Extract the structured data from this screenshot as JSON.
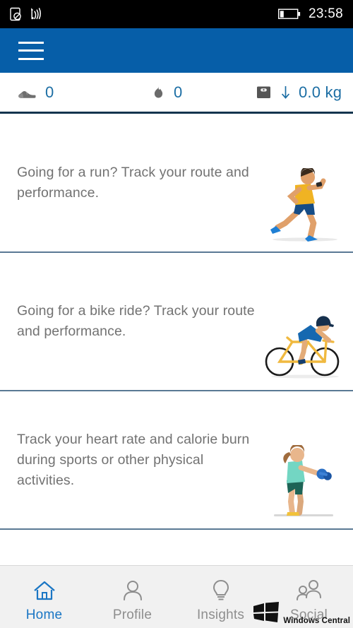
{
  "status_bar": {
    "no_sim_icon": "no-sim-icon",
    "wifi_icon": "wifi-icon",
    "battery_icon": "battery-low-icon",
    "time": "23:58"
  },
  "app_bar": {
    "menu_icon": "hamburger-menu-icon",
    "background_color": "#065ea8"
  },
  "stats": {
    "accent_color": "#1c6ea4",
    "items": [
      {
        "icon": "shoe-icon",
        "value": "0",
        "metric": "steps"
      },
      {
        "icon": "flame-icon",
        "value": "0",
        "metric": "calories"
      },
      {
        "icon": "scale-icon",
        "value": "0.0 kg",
        "metric": "weight",
        "trend_icon": "arrow-down-icon"
      }
    ]
  },
  "cards": [
    {
      "text": "Going for a run? Track your route and performance.",
      "art": "runner-illustration"
    },
    {
      "text": "Going for a bike ride? Track your route and performance.",
      "art": "cyclist-illustration"
    },
    {
      "text": "Track your heart rate and calorie burn during sports or other physical activities.",
      "art": "workout-illustration"
    }
  ],
  "bottom_nav": {
    "active_color": "#1a76c4",
    "inactive_color": "#8e8e8e",
    "items": [
      {
        "label": "Home",
        "icon": "home-icon",
        "active": true
      },
      {
        "label": "Profile",
        "icon": "person-icon",
        "active": false
      },
      {
        "label": "Insights",
        "icon": "lightbulb-icon",
        "active": false
      },
      {
        "label": "Social",
        "icon": "people-icon",
        "active": false
      }
    ]
  },
  "watermark": {
    "logo_icon": "windows-logo-icon",
    "text": "Windows Central"
  }
}
